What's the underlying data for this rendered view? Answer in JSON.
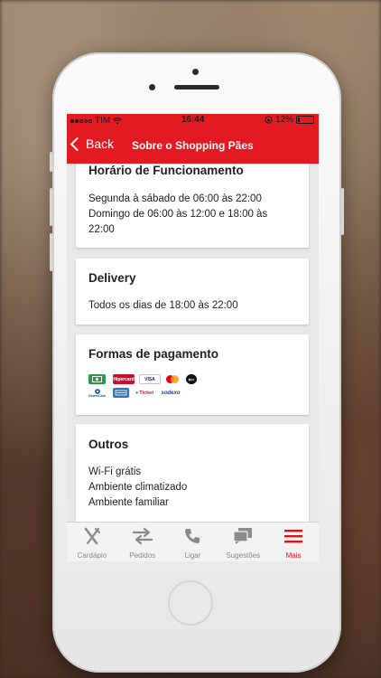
{
  "statusbar": {
    "carrier": "TIM",
    "time": "16:44",
    "battery": "12%"
  },
  "navbar": {
    "back_label": "Back",
    "title": "Sobre o Shopping Pães"
  },
  "sections": {
    "hours": {
      "title": "Horário de Funcionamento",
      "line1": "Segunda à sábado de 06:00 às 22:00",
      "line2": "Domingo de 06:00 às 12:00 e 18:00 às",
      "line3": "22:00"
    },
    "delivery": {
      "title": "Delivery",
      "line1": "Todos os dias de 18:00 às 22:00"
    },
    "payment": {
      "title": "Formas de pagamento",
      "methods": [
        "Dinheiro",
        "Hipercard",
        "VISA",
        "Mastercard",
        "Elo",
        "Diners Club",
        "American Express",
        "Ticket",
        "Sodexo"
      ],
      "hipercard_label": "Hipercard",
      "visa_label": "VISA",
      "ticket_label": "Ticket",
      "sodexo_label": "sodexo",
      "diners_label": "DinersClub"
    },
    "others": {
      "title": "Outros",
      "line1": "Wi-Fi grátis",
      "line2": "Ambiente climatizado",
      "line3": "Ambiente familiar"
    }
  },
  "tabbar": {
    "items": [
      {
        "label": "Cardápio",
        "icon": "fork-knife-icon"
      },
      {
        "label": "Pedidos",
        "icon": "swap-arrows-icon"
      },
      {
        "label": "Ligar",
        "icon": "phone-icon"
      },
      {
        "label": "Sugestões",
        "icon": "chat-bubbles-icon"
      },
      {
        "label": "Mais",
        "icon": "hamburger-menu-icon"
      }
    ],
    "active": "Mais"
  },
  "colors": {
    "brand_red": "#e31a22",
    "active_tab": "#d6161c",
    "inactive_tab": "#8a8a8a"
  }
}
